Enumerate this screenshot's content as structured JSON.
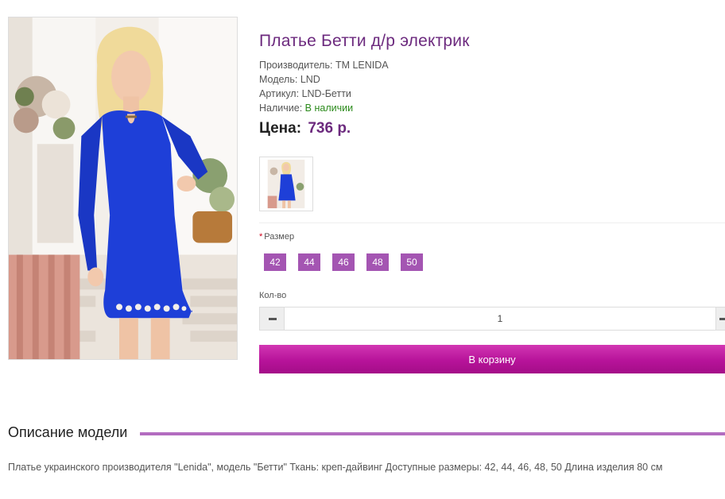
{
  "product": {
    "title": "Платье Бетти д/р электрик",
    "manufacturer": {
      "label": "Производитель:",
      "value": "TM LENIDA"
    },
    "model": {
      "label": "Модель:",
      "value": "LND"
    },
    "sku": {
      "label": "Артикул:",
      "value": "LND-Бетти"
    },
    "availability": {
      "label": "Наличие:",
      "value": "В наличии"
    },
    "price": {
      "label": "Цена:",
      "value": "736 р."
    }
  },
  "options": {
    "size_label": "Размер",
    "required_mark": "*",
    "sizes": [
      "42",
      "44",
      "46",
      "48",
      "50"
    ]
  },
  "quantity": {
    "label": "Кол-во",
    "value": "1"
  },
  "cart": {
    "button_label": "В корзину"
  },
  "description": {
    "heading": "Описание модели",
    "text": "Платье украинского производителя \"Lenida\", модель \"Бетти\" Ткань: креп-дайвинг Доступные размеры: 42, 44, 46, 48, 50 Длина изделия 80 см"
  },
  "colors": {
    "title": "#6c2a7e",
    "accent": "#a455b2",
    "cart_button": "#b7139a",
    "in_stock": "#2a8a1a",
    "dress": "#1e3fd8"
  }
}
